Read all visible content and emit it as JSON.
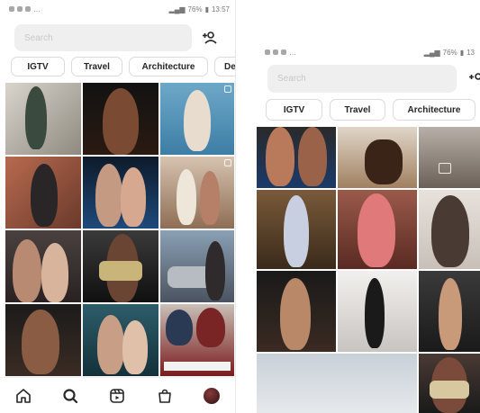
{
  "left": {
    "status": {
      "battery": "76%",
      "time": "13:57"
    },
    "search": {
      "placeholder": "Search"
    },
    "chips": [
      "IGTV",
      "Travel",
      "Architecture",
      "De"
    ]
  },
  "right": {
    "status": {
      "battery": "76%",
      "time": "13"
    },
    "search": {
      "placeholder": "Search"
    },
    "chips": [
      "IGTV",
      "Travel",
      "Architecture",
      ""
    ]
  },
  "icons": {
    "add_person": "add-person-icon",
    "home": "home-icon",
    "search": "search-icon",
    "reels": "reels-icon",
    "shop": "shop-icon",
    "profile": "profile-avatar-icon"
  },
  "colors": {
    "chip_border": "#dbdbdb",
    "search_bg": "#efefef",
    "text": "#262626"
  }
}
